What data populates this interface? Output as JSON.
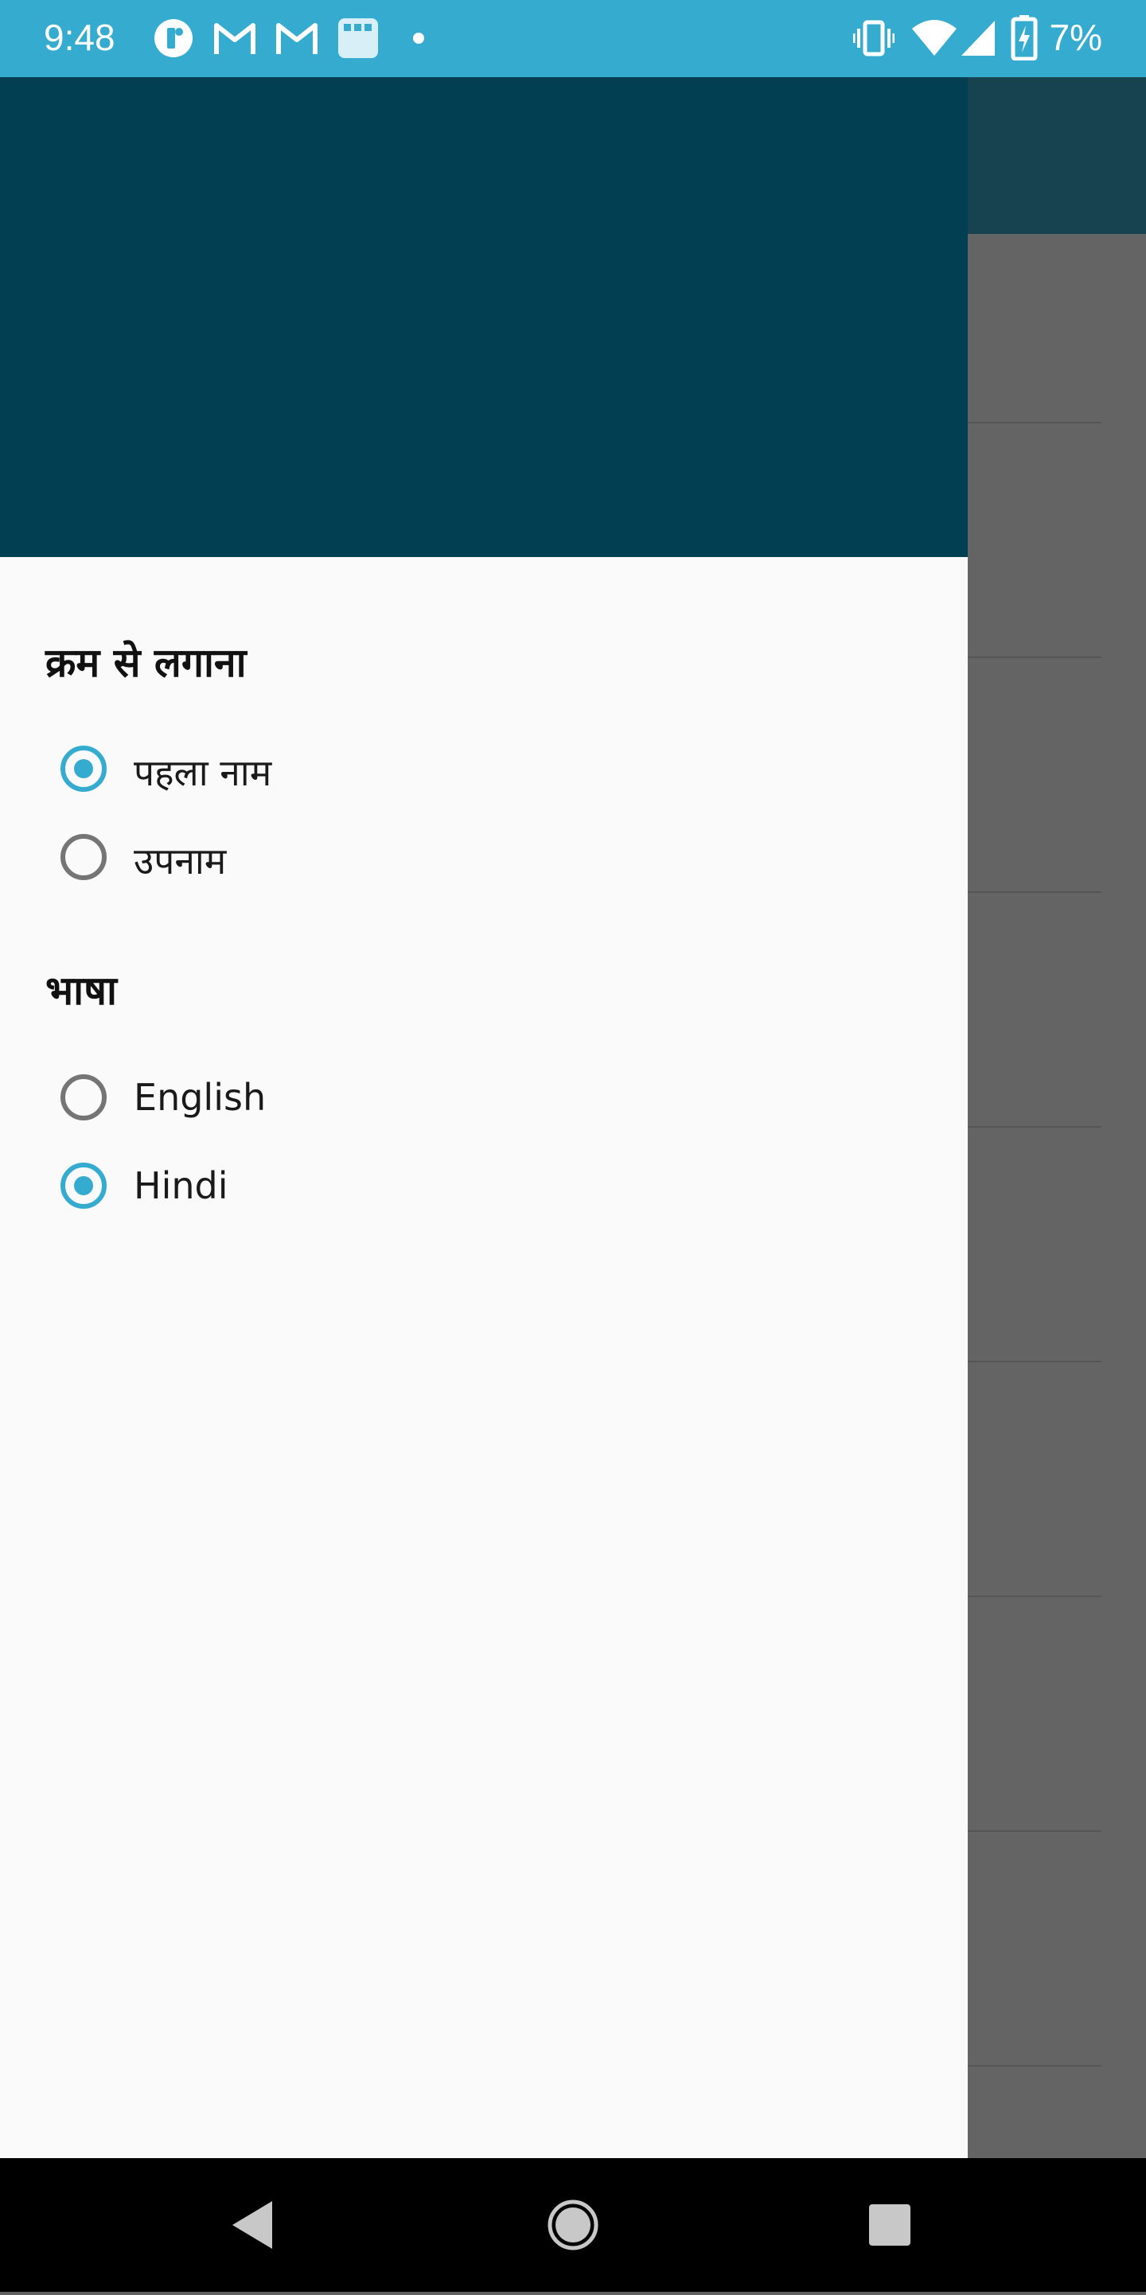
{
  "status_bar": {
    "time": "9:48",
    "battery": "7%",
    "icons": [
      "app-icon",
      "gmail-icon",
      "gmail-icon",
      "calendar-icon",
      "dot-icon",
      "vibrate-icon",
      "wifi-icon",
      "signal-icon",
      "battery-charging-icon"
    ]
  },
  "drawer": {
    "sort_section": {
      "title": "क्रम से लगाना",
      "options": [
        {
          "label": "पहला नाम",
          "checked": true
        },
        {
          "label": "उपनाम",
          "checked": false
        }
      ]
    },
    "language_section": {
      "title": "भाषा",
      "options": [
        {
          "label": "English",
          "checked": false
        },
        {
          "label": "Hindi",
          "checked": true
        }
      ]
    }
  },
  "colors": {
    "status_bar": "#35abd0",
    "drawer_header": "#023f52",
    "accent": "#35abd0",
    "scrim_content": "#646464"
  },
  "nav_bar": {
    "buttons": [
      "back-icon",
      "home-icon",
      "recents-icon"
    ]
  }
}
